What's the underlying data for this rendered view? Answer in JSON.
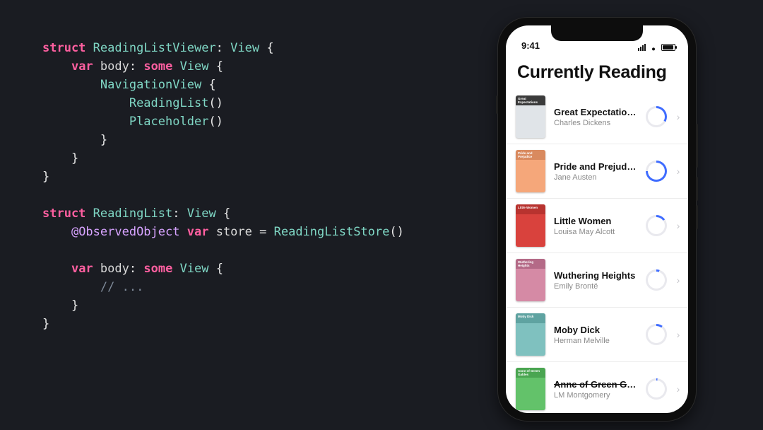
{
  "code": {
    "lines": [
      [
        [
          "kw",
          "struct"
        ],
        [
          "punc",
          " "
        ],
        [
          "type",
          "ReadingListViewer"
        ],
        [
          "punc",
          ": "
        ],
        [
          "type",
          "View"
        ],
        [
          "punc",
          " {"
        ]
      ],
      [
        [
          "punc",
          "    "
        ],
        [
          "kw",
          "var"
        ],
        [
          "punc",
          " "
        ],
        [
          "name",
          "body"
        ],
        [
          "punc",
          ": "
        ],
        [
          "kw",
          "some"
        ],
        [
          "punc",
          " "
        ],
        [
          "type",
          "View"
        ],
        [
          "punc",
          " {"
        ]
      ],
      [
        [
          "punc",
          "        "
        ],
        [
          "type",
          "NavigationView"
        ],
        [
          "punc",
          " {"
        ]
      ],
      [
        [
          "punc",
          "            "
        ],
        [
          "type",
          "ReadingList"
        ],
        [
          "punc",
          "()"
        ]
      ],
      [
        [
          "punc",
          "            "
        ],
        [
          "type",
          "Placeholder"
        ],
        [
          "punc",
          "()"
        ]
      ],
      [
        [
          "punc",
          "        }"
        ]
      ],
      [
        [
          "punc",
          "    }"
        ]
      ],
      [
        [
          "punc",
          "}"
        ]
      ],
      [
        [
          "punc",
          ""
        ]
      ],
      [
        [
          "kw",
          "struct"
        ],
        [
          "punc",
          " "
        ],
        [
          "type",
          "ReadingList"
        ],
        [
          "punc",
          ": "
        ],
        [
          "type",
          "View"
        ],
        [
          "punc",
          " {"
        ]
      ],
      [
        [
          "punc",
          "    "
        ],
        [
          "attr",
          "@ObservedObject"
        ],
        [
          "punc",
          " "
        ],
        [
          "kw",
          "var"
        ],
        [
          "punc",
          " "
        ],
        [
          "name",
          "store"
        ],
        [
          "punc",
          " = "
        ],
        [
          "type",
          "ReadingListStore"
        ],
        [
          "punc",
          "()"
        ]
      ],
      [
        [
          "punc",
          ""
        ]
      ],
      [
        [
          "punc",
          "    "
        ],
        [
          "kw",
          "var"
        ],
        [
          "punc",
          " "
        ],
        [
          "name",
          "body"
        ],
        [
          "punc",
          ": "
        ],
        [
          "kw",
          "some"
        ],
        [
          "punc",
          " "
        ],
        [
          "type",
          "View"
        ],
        [
          "punc",
          " {"
        ]
      ],
      [
        [
          "punc",
          "        "
        ],
        [
          "comm",
          "// ..."
        ]
      ],
      [
        [
          "punc",
          "    }"
        ]
      ],
      [
        [
          "punc",
          "}"
        ]
      ]
    ]
  },
  "phone": {
    "status_time": "9:41",
    "screen_title": "Currently Reading",
    "books": [
      {
        "title": "Great Expectations",
        "author": "Charles Dickens",
        "progress": 0.33,
        "cover_bg": "#e0e4e8",
        "cover_top": "#3b3b3b",
        "label_top": "Great\nExpectations",
        "label_sub": "Charles Dickens"
      },
      {
        "title": "Pride and Prejudice",
        "author": "Jane Austen",
        "progress": 0.75,
        "cover_bg": "#f5a77a",
        "cover_top": "#d98a5f",
        "label_top": "Pride and\nPrejudice",
        "label_sub": "Jane Austen"
      },
      {
        "title": "Little Women",
        "author": "Louisa May Alcott",
        "progress": 0.15,
        "cover_bg": "#d9423d",
        "cover_top": "#b8332f",
        "label_top": "Little Women",
        "label_sub": "Louisa May Alcott"
      },
      {
        "title": "Wuthering Heights",
        "author": "Emily Brontë",
        "progress": 0.05,
        "cover_bg": "#d58aa5",
        "cover_top": "#b46a87",
        "label_top": "Wuthering Heights",
        "label_sub": "Emily Brontë"
      },
      {
        "title": "Moby Dick",
        "author": "Herman Melville",
        "progress": 0.1,
        "cover_bg": "#7fc1bf",
        "cover_top": "#5fa3a1",
        "label_top": "Moby Dick",
        "label_sub": "Herman Melville"
      },
      {
        "title": "Anne of Green Gables",
        "author": "LM Montgomery",
        "progress": 0.02,
        "cover_bg": "#63c26a",
        "cover_top": "#4aa551",
        "label_top": "Anne of Green\nGables",
        "label_sub": "LM Montgomery"
      }
    ],
    "progress_track": "#e9e9ee",
    "progress_color": "#3f6cff"
  }
}
